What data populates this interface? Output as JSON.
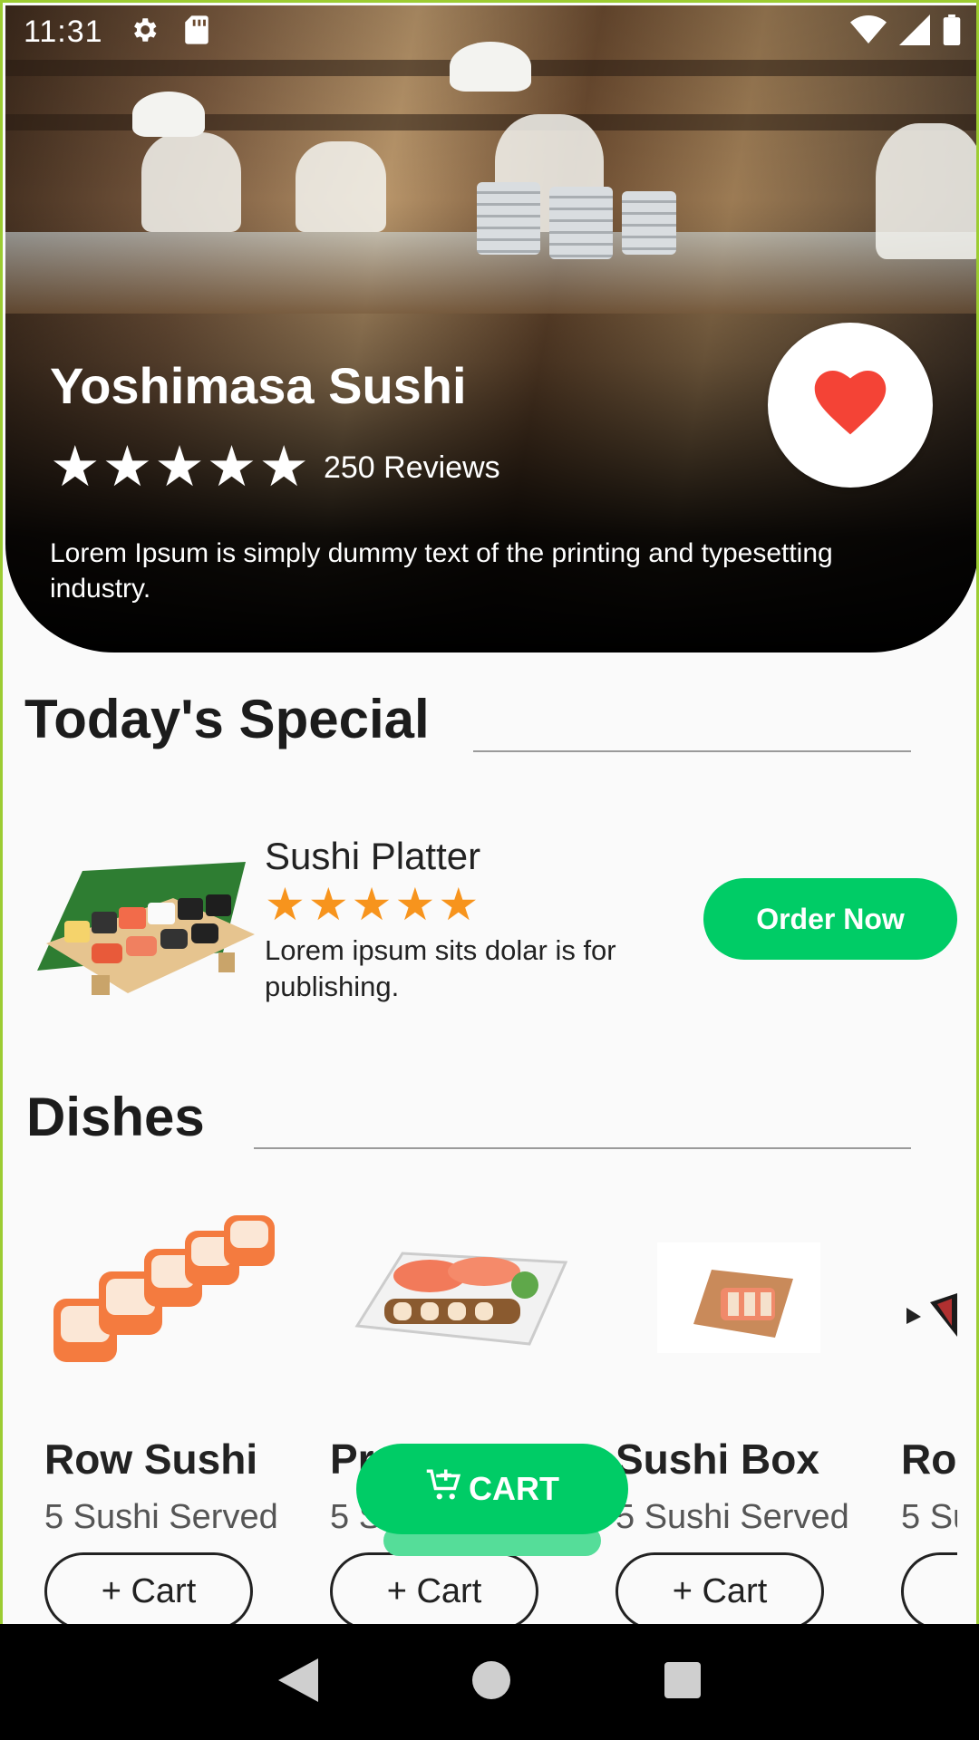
{
  "status_bar": {
    "time": "11:31"
  },
  "restaurant": {
    "name": "Yoshimasa Sushi",
    "rating": 5,
    "reviews": "250 Reviews",
    "description": "Lorem Ipsum is simply dummy text of the printing and typesetting industry."
  },
  "todays_special": {
    "title": "Today's Special",
    "item": {
      "name": "Sushi Platter",
      "rating": 5,
      "description": "Lorem ipsum sits dolar is for publishing.",
      "order_label": "Order Now"
    }
  },
  "dishes": {
    "title": "Dishes",
    "items": [
      {
        "name": "Row Sushi",
        "served": "5 Sushi Served",
        "cart_label": "+ Cart"
      },
      {
        "name": "Pr",
        "served": "5 S",
        "cart_label": "+ Cart"
      },
      {
        "name": "Sushi Box",
        "served": "5 Sushi Served",
        "cart_label": "+ Cart"
      },
      {
        "name": "Ro",
        "served": "5 Su",
        "cart_label": ""
      }
    ]
  },
  "cart_fab": {
    "label": "CART"
  },
  "colors": {
    "accent": "#00cc66",
    "star_orange": "#f7941d",
    "heart": "#f44336"
  },
  "icons": [
    "gear-icon",
    "sd-card-icon",
    "wifi-icon",
    "signal-icon",
    "battery-icon",
    "heart-icon",
    "cart-icon",
    "back-icon",
    "home-icon",
    "recents-icon"
  ]
}
